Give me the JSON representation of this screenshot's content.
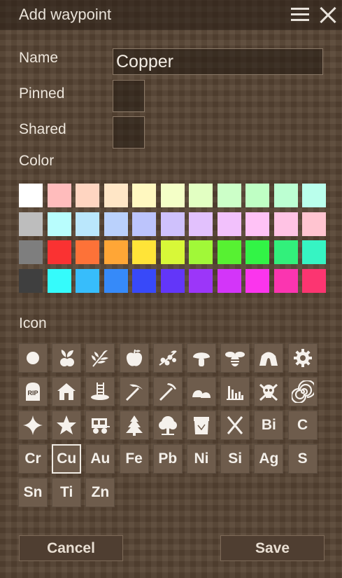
{
  "dialog": {
    "title": "Add waypoint"
  },
  "form": {
    "name_label": "Name",
    "name_value": "Copper",
    "pinned_label": "Pinned",
    "pinned_checked": false,
    "shared_label": "Shared",
    "shared_checked": false,
    "color_label": "Color",
    "icon_label": "Icon"
  },
  "colors": [
    "#ffffff",
    "#ffbcbc",
    "#ffd5c1",
    "#ffe6c6",
    "#fff8c0",
    "#f4ffc7",
    "#e2ffc2",
    "#ccffc8",
    "#bfffc4",
    "#bcffd2",
    "#baffec",
    "#bdbdbd",
    "#b8fdfd",
    "#bae7fc",
    "#bad1fc",
    "#bcc4fc",
    "#cfc1fc",
    "#e2c1fd",
    "#f2c1fc",
    "#ffc2f6",
    "#ffc3e4",
    "#ffc4d0",
    "#7e7e7e",
    "#fa3232",
    "#fd7238",
    "#ffa636",
    "#ffe438",
    "#d8f838",
    "#a1f838",
    "#57f132",
    "#32f446",
    "#32f07b",
    "#36f4c3",
    "#3f3f3f",
    "#35fbfb",
    "#37bdfb",
    "#368af9",
    "#3849f9",
    "#6336f9",
    "#9c36f9",
    "#d335f9",
    "#fb35ed",
    "#fb35b0",
    "#fc3571"
  ],
  "selected_color": 0,
  "icons": [
    {
      "name": "circle-icon",
      "type": "svg"
    },
    {
      "name": "turnip-icon",
      "type": "svg"
    },
    {
      "name": "grain-icon",
      "type": "svg"
    },
    {
      "name": "apple-icon",
      "type": "svg"
    },
    {
      "name": "berries-icon",
      "type": "svg"
    },
    {
      "name": "mushroom-icon",
      "type": "svg"
    },
    {
      "name": "bee-icon",
      "type": "svg"
    },
    {
      "name": "cave-icon",
      "type": "svg"
    },
    {
      "name": "gear-icon",
      "type": "svg"
    },
    {
      "name": "gravestone-icon",
      "type": "svg",
      "text": "RIP"
    },
    {
      "name": "house-icon",
      "type": "svg"
    },
    {
      "name": "ladder-icon",
      "type": "svg"
    },
    {
      "name": "pickaxe-icon",
      "type": "svg"
    },
    {
      "name": "pick-icon",
      "type": "svg"
    },
    {
      "name": "rocks-icon",
      "type": "svg"
    },
    {
      "name": "ruins-icon",
      "type": "svg"
    },
    {
      "name": "skull-icon",
      "type": "svg"
    },
    {
      "name": "spiral-icon",
      "type": "svg"
    },
    {
      "name": "star4-icon",
      "type": "svg"
    },
    {
      "name": "star5-icon",
      "type": "svg"
    },
    {
      "name": "wagon-icon",
      "type": "svg"
    },
    {
      "name": "tree-icon",
      "type": "svg"
    },
    {
      "name": "deciduous-tree-icon",
      "type": "svg"
    },
    {
      "name": "vessel-icon",
      "type": "svg"
    },
    {
      "name": "crossed-swords-icon",
      "type": "svg"
    },
    {
      "name": "icon-bi",
      "type": "text",
      "text": "Bi"
    },
    {
      "name": "icon-c",
      "type": "text",
      "text": "C"
    },
    {
      "name": "icon-cr",
      "type": "text",
      "text": "Cr"
    },
    {
      "name": "icon-cu",
      "type": "text",
      "text": "Cu"
    },
    {
      "name": "icon-au",
      "type": "text",
      "text": "Au"
    },
    {
      "name": "icon-fe",
      "type": "text",
      "text": "Fe"
    },
    {
      "name": "icon-pb",
      "type": "text",
      "text": "Pb"
    },
    {
      "name": "icon-ni",
      "type": "text",
      "text": "Ni"
    },
    {
      "name": "icon-si",
      "type": "text",
      "text": "Si"
    },
    {
      "name": "icon-ag",
      "type": "text",
      "text": "Ag"
    },
    {
      "name": "icon-s",
      "type": "text",
      "text": "S"
    },
    {
      "name": "icon-sn",
      "type": "text",
      "text": "Sn"
    },
    {
      "name": "icon-ti",
      "type": "text",
      "text": "Ti"
    },
    {
      "name": "icon-zn",
      "type": "text",
      "text": "Zn"
    }
  ],
  "selected_icon": "Cu",
  "buttons": {
    "cancel": "Cancel",
    "save": "Save"
  }
}
